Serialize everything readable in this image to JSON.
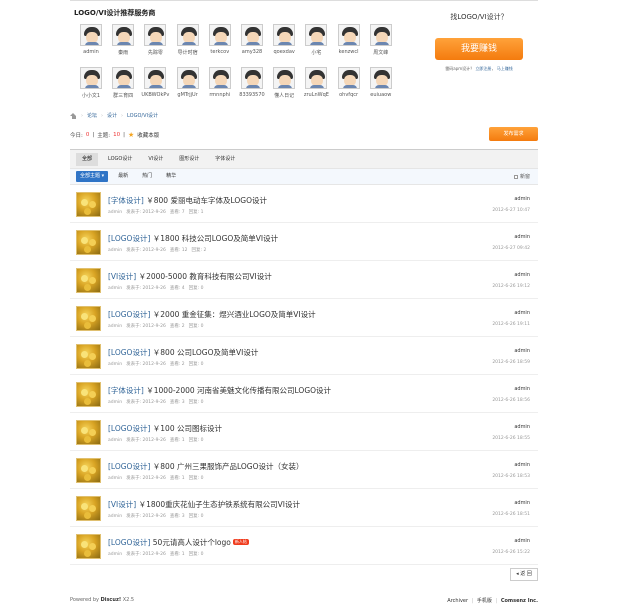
{
  "providers": {
    "title": "LOGO/VI设计推荐服务商",
    "users": [
      "admin",
      "秦雨",
      "先踪零",
      "导计时宿",
      "terkcov",
      "amy328",
      "qoexdav",
      "小宅",
      "kenzwcl",
      "周文峰",
      "小小文1",
      "群三育四",
      "UKBWOkPv",
      "gMTrjjUr",
      "rmnnphi",
      "83393570",
      "懂人日记",
      "zruLnWqE",
      "ohvfqcr",
      "euiuaow"
    ]
  },
  "promo": {
    "question": "找LOGO/VI设计？",
    "earn_label": "我要赚钱",
    "sub_text": "雷码apm设计？",
    "sub_link1": "立即注册",
    "sub_link2": "马上赚钱"
  },
  "breadcrumb": [
    "论坛",
    "设计",
    "LOGO/VI设计"
  ],
  "stats": {
    "today_label": "今日:",
    "today": "0",
    "topics_label": "主题:",
    "topics": "10",
    "fav_label": "收藏本版"
  },
  "post_button": "发布需求",
  "type_tabs": [
    "全部",
    "LOGO设计",
    "VI设计",
    "图形设计",
    "字体设计"
  ],
  "filters": [
    "全部主题 ▾",
    "最新",
    "热门",
    "精华"
  ],
  "new_window": "新窗",
  "threads": [
    {
      "type": "[字体设计]",
      "title": "￥800 爱丽电动车字体及LOGO设计",
      "hot": "",
      "author": "admin",
      "posted": "发表于: 2012-9-26",
      "views": "查看: 7",
      "replies": "回复: 1",
      "last_user": "admin",
      "last_date": "2012-6-27 10:47"
    },
    {
      "type": "[LOGO设计]",
      "title": "￥1800 科技公司LOGO及简单VI设计",
      "hot": "",
      "author": "admin",
      "posted": "发表于: 2012-9-26",
      "views": "查看: 12",
      "replies": "回复: 2",
      "last_user": "admin",
      "last_date": "2012-6-27 09:42"
    },
    {
      "type": "[VI设计]",
      "title": "￥2000-5000 教育科技有限公司VI设计",
      "hot": "",
      "author": "admin",
      "posted": "发表于: 2012-9-26",
      "views": "查看: 4",
      "replies": "回复: 0",
      "last_user": "admin",
      "last_date": "2012-6-26 19:12"
    },
    {
      "type": "[LOGO设计]",
      "title": "￥2000 重金征集：煜兴酒业LOGO及简单VI设计",
      "hot": "",
      "author": "admin",
      "posted": "发表于: 2012-9-26",
      "views": "查看: 2",
      "replies": "回复: 0",
      "last_user": "admin",
      "last_date": "2012-6-26 19:11"
    },
    {
      "type": "[LOGO设计]",
      "title": "￥800 公司LOGO及简单VI设计",
      "hot": "",
      "author": "admin",
      "posted": "发表于: 2012-9-26",
      "views": "查看: 2",
      "replies": "回复: 0",
      "last_user": "admin",
      "last_date": "2012-6-26 18:59"
    },
    {
      "type": "[字体设计]",
      "title": "￥1000-2000 河南省美魅文化传播有限公司LOGO设计",
      "hot": "",
      "author": "admin",
      "posted": "发表于: 2012-9-26",
      "views": "查看: 3",
      "replies": "回复: 0",
      "last_user": "admin",
      "last_date": "2012-6-26 18:56"
    },
    {
      "type": "[LOGO设计]",
      "title": "￥100 公司图标设计",
      "hot": "",
      "author": "admin",
      "posted": "发表于: 2012-9-26",
      "views": "查看: 1",
      "replies": "回复: 0",
      "last_user": "admin",
      "last_date": "2012-6-26 18:55"
    },
    {
      "type": "[LOGO设计]",
      "title": "￥800 广州三果服饰产品LOGO设计（女装）",
      "hot": "",
      "author": "admin",
      "posted": "发表于: 2012-9-26",
      "views": "查看: 1",
      "replies": "回复: 0",
      "last_user": "admin",
      "last_date": "2012-6-26 18:53"
    },
    {
      "type": "[VI设计]",
      "title": "￥1800重庆花仙子生态护铁系统有限公司VI设计",
      "hot": "",
      "author": "admin",
      "posted": "发表于: 2012-9-26",
      "views": "查看: 3",
      "replies": "回复: 0",
      "last_user": "admin",
      "last_date": "2012-6-26 18:51"
    },
    {
      "type": "[LOGO设计]",
      "title": "50元请高人设计个logo",
      "hot": "新人帖",
      "author": "admin",
      "posted": "发表于: 2012-9-26",
      "views": "查看: 1",
      "replies": "回复: 0",
      "last_user": "admin",
      "last_date": "2012-6-26 15:22"
    }
  ],
  "pager_label": "◂ 返 回",
  "footer": {
    "powered": "Powered by",
    "brand": "Discuz!",
    "version": "X2.5",
    "links": [
      "Archiver",
      "手机版",
      "Comsenz Inc."
    ]
  }
}
